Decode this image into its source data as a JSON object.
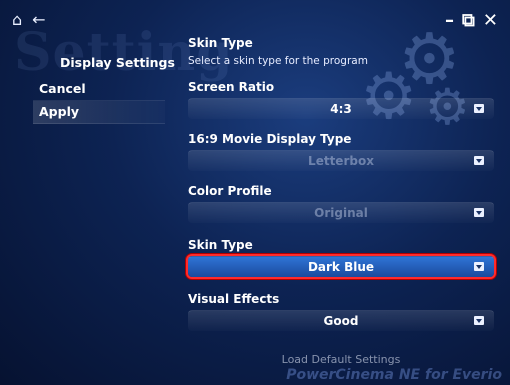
{
  "header": {
    "watermark": "Setting",
    "home_icon": "home-icon",
    "back_icon": "back-arrow-icon",
    "minimize": "–",
    "restore": "⧉",
    "close": "✕"
  },
  "left": {
    "title": "Display Settings",
    "menu": [
      {
        "label": "Cancel"
      },
      {
        "label": "Apply"
      }
    ]
  },
  "panel": {
    "title": "Skin Type",
    "subtitle": "Select a skin type for the program"
  },
  "settings": [
    {
      "label": "Screen Ratio",
      "value": "4:3"
    },
    {
      "label": "16:9 Movie Display Type",
      "value": "Letterbox"
    },
    {
      "label": "Color Profile",
      "value": "Original"
    },
    {
      "label": "Skin Type",
      "value": "Dark Blue"
    },
    {
      "label": "Visual Effects",
      "value": "Good"
    }
  ],
  "load_button": "Load Default Settings",
  "brand": "PowerCinema NE for Everio",
  "colors": {
    "highlight": "#ff2b2b",
    "selected_fill": "#2f74d6"
  }
}
